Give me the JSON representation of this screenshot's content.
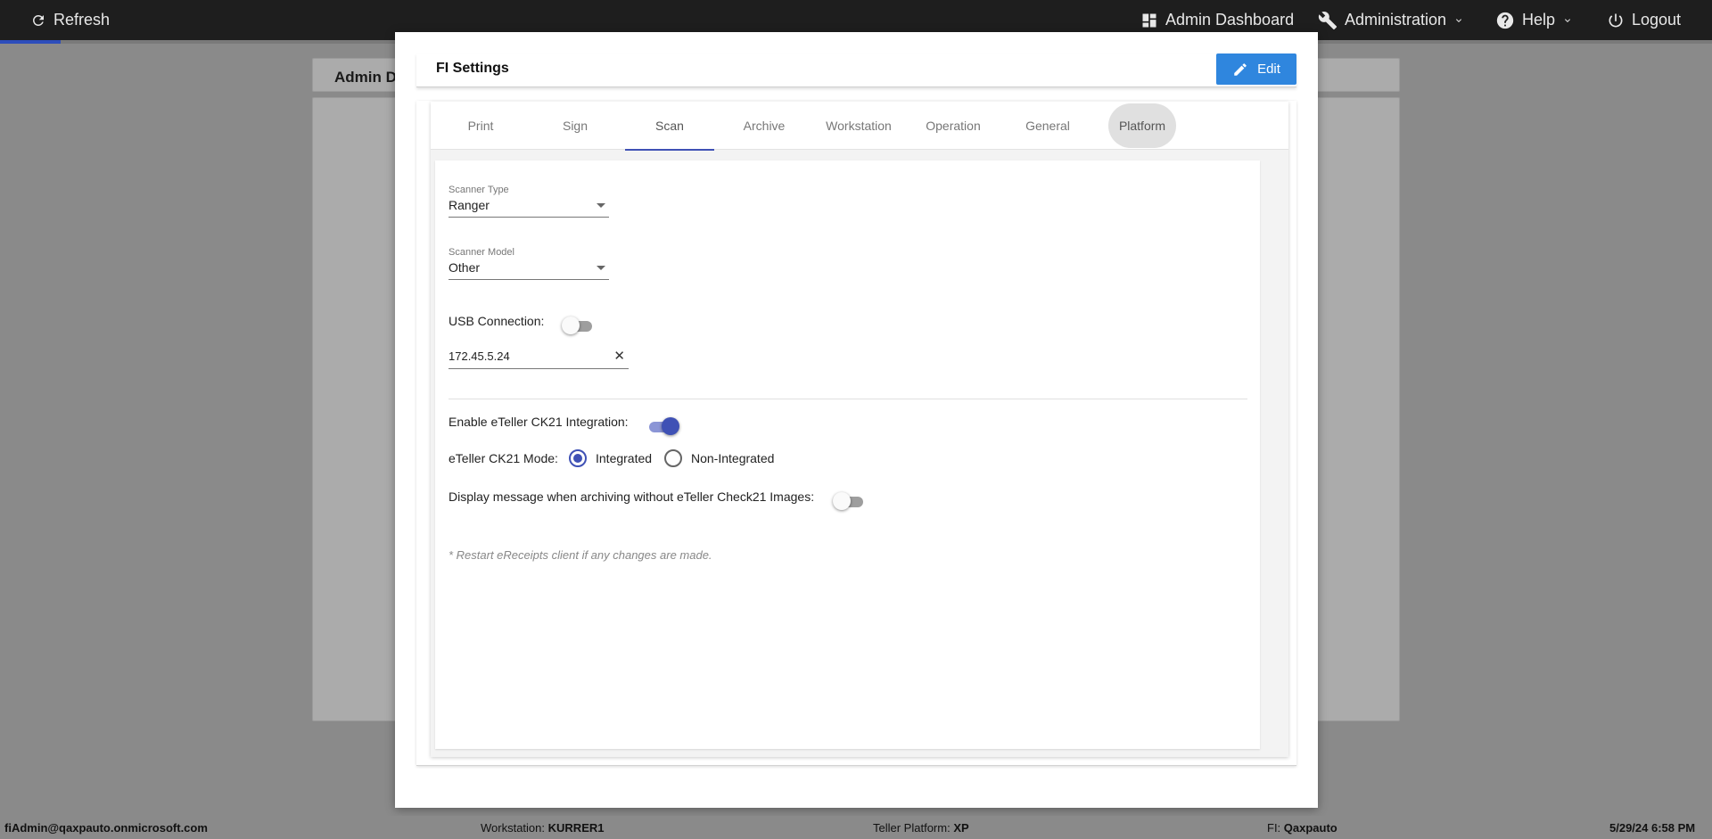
{
  "topbar": {
    "refresh_label": "Refresh",
    "admin_dashboard_label": "Admin Dashboard",
    "administration_label": "Administration",
    "help_label": "Help",
    "logout_label": "Logout"
  },
  "background": {
    "page_title_partial": "Admin D"
  },
  "modal": {
    "title": "FI Settings",
    "edit_label": "Edit",
    "tabs": [
      {
        "label": "Print"
      },
      {
        "label": "Sign"
      },
      {
        "label": "Scan",
        "active": true
      },
      {
        "label": "Archive"
      },
      {
        "label": "Workstation"
      },
      {
        "label": "Operation"
      },
      {
        "label": "General"
      },
      {
        "label": "Platform"
      }
    ],
    "scan": {
      "scanner_type_label": "Scanner Type",
      "scanner_type_value": "Ranger",
      "scanner_model_label": "Scanner Model",
      "scanner_model_value": "Other",
      "usb_connection_label": "USB Connection:",
      "usb_connection_on": false,
      "ip_address_value": "172.45.5.24",
      "ck21_integration_label": "Enable eTeller CK21 Integration:",
      "ck21_integration_on": true,
      "ck21_mode_label": "eTeller CK21 Mode:",
      "mode_integrated_label": "Integrated",
      "mode_non_integrated_label": "Non-Integrated",
      "mode_selected": "Integrated",
      "display_message_label": "Display message when archiving without eTeller Check21 Images:",
      "display_message_on": false,
      "restart_note": "* Restart eReceipts client if any changes are made."
    }
  },
  "statusbar": {
    "user": "fiAdmin@qaxpauto.onmicrosoft.com",
    "workstation_label": "Workstation:",
    "workstation_value": "KURRER1",
    "teller_platform_label": "Teller Platform:",
    "teller_platform_value": "XP",
    "fi_label": "FI:",
    "fi_value": "Qaxpauto",
    "datetime": "5/29/24 6:58 PM"
  },
  "colors": {
    "accent": "#3f51b5",
    "edit_button": "#2f86de",
    "topbar": "#1e1e1e"
  }
}
